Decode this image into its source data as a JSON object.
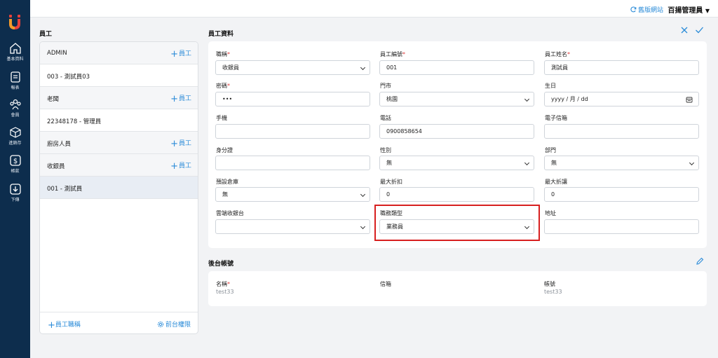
{
  "nav": {
    "items": [
      {
        "label": "基本資料",
        "icon": "home-icon"
      },
      {
        "label": "報表",
        "icon": "report-icon"
      },
      {
        "label": "會員",
        "icon": "members-icon"
      },
      {
        "label": "進銷存",
        "icon": "inventory-box-icon"
      },
      {
        "label": "帳款",
        "icon": "dollar-icon"
      },
      {
        "label": "下傳",
        "icon": "download-icon"
      }
    ],
    "logo_color": "#e8413c"
  },
  "topbar": {
    "old_site": "舊版網站",
    "user": "百揚管理員"
  },
  "employees": {
    "title": "員工",
    "add_label": "員工",
    "rows": [
      {
        "text": "ADMIN",
        "type": "group"
      },
      {
        "text": "003 - 測試員03",
        "type": "item"
      },
      {
        "text": "老闆",
        "type": "group"
      },
      {
        "text": "22348178 - 管理員",
        "type": "item"
      },
      {
        "text": "廚房人員",
        "type": "group"
      },
      {
        "text": "收銀員",
        "type": "group"
      },
      {
        "text": "001 - 測試員",
        "type": "selected"
      }
    ],
    "footer_add_role": "員工職稱",
    "footer_permission": "前台權限"
  },
  "form": {
    "title": "員工資料",
    "fields": {
      "job_title": {
        "label": "職稱",
        "value": "收銀員"
      },
      "emp_no": {
        "label": "員工編號",
        "value": "001"
      },
      "emp_name": {
        "label": "員工姓名",
        "value": "測試員"
      },
      "password": {
        "label": "密碼",
        "value": "•••"
      },
      "store": {
        "label": "門市",
        "value": "桃園"
      },
      "birthday": {
        "label": "生日",
        "placeholder": "yyyy / 月 / dd"
      },
      "mobile": {
        "label": "手機",
        "value": ""
      },
      "phone": {
        "label": "電話",
        "value": "0900858654"
      },
      "email": {
        "label": "電子信箱",
        "value": ""
      },
      "id_no": {
        "label": "身分證",
        "value": ""
      },
      "gender": {
        "label": "性別",
        "value": "無"
      },
      "department": {
        "label": "部門",
        "value": "無"
      },
      "warehouse": {
        "label": "預設倉庫",
        "value": "無"
      },
      "max_discount": {
        "label": "最大折扣",
        "value": "0"
      },
      "max_allowance": {
        "label": "最大折讓",
        "value": "0"
      },
      "cloud_pos": {
        "label": "雲端收銀台",
        "value": ""
      },
      "job_type": {
        "label": "職務類型",
        "value": "業務員"
      },
      "address": {
        "label": "地址",
        "value": ""
      }
    }
  },
  "account": {
    "title": "後台帳號",
    "name_label": "名稱",
    "name_value": "test33",
    "email_label": "信箱",
    "email_value": "",
    "acct_label": "帳號",
    "acct_value": "test33"
  },
  "colors": {
    "accent": "#2a8bd8",
    "nav_bg": "#0d2d4d",
    "highlight": "#d71f1f",
    "required": "#e03c3c"
  }
}
